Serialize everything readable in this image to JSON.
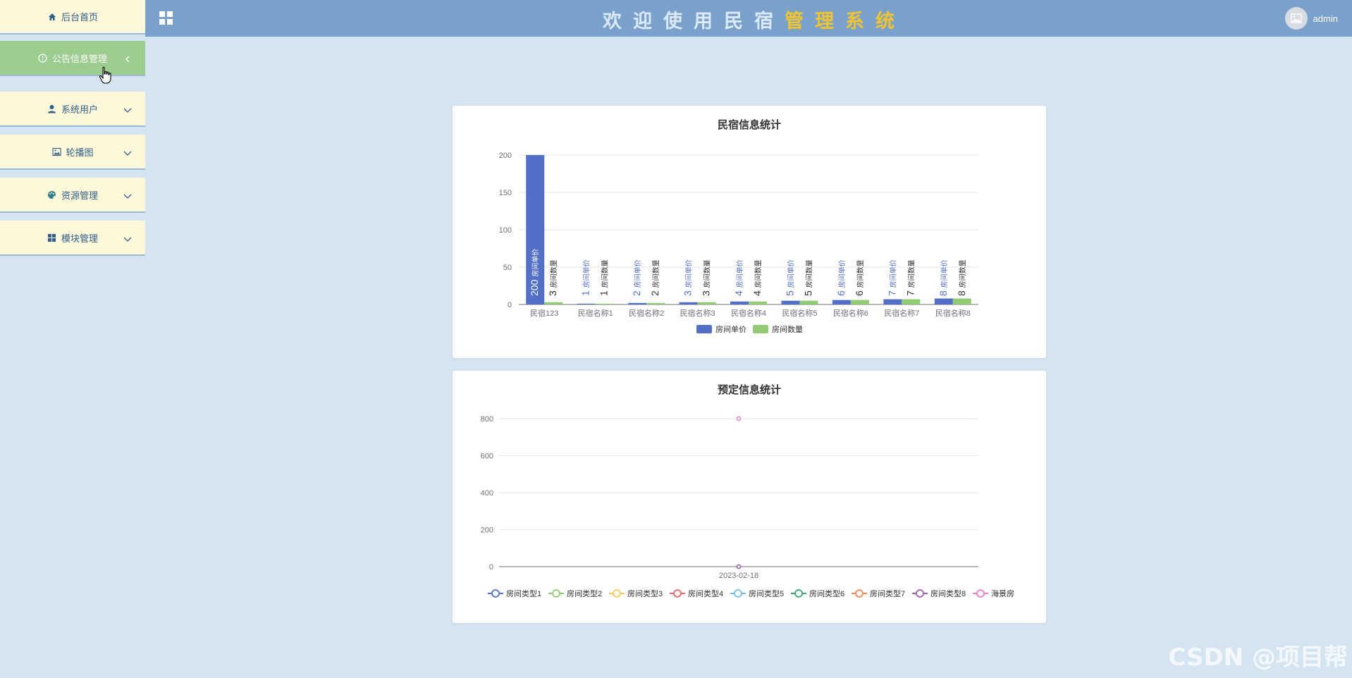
{
  "sidebar": {
    "items": [
      {
        "label": "后台首页",
        "icon": "home-icon"
      },
      {
        "label": "公告信息管理",
        "icon": "info-icon"
      },
      {
        "label": "系统用户",
        "icon": "user-icon"
      },
      {
        "label": "轮播图",
        "icon": "image-icon"
      },
      {
        "label": "资源管理",
        "icon": "paint-icon"
      },
      {
        "label": "模块管理",
        "icon": "grid-icon"
      }
    ]
  },
  "header": {
    "title_chars": [
      "欢",
      "迎",
      "使",
      "用",
      "民",
      "宿",
      "管",
      "理",
      "系",
      "统"
    ],
    "user_name": "admin"
  },
  "colors": {
    "sidebar_bg": "#fdf8d9",
    "sidebar_active_bg": "#9ccc8e",
    "header_bg": "#7aa0cc",
    "page_bg": "#d4e4f1",
    "title_light": "#dce9f7",
    "title_accent": "#f0c331"
  },
  "chart_data": [
    {
      "type": "bar",
      "title": "民宿信息统计",
      "categories": [
        "民宿123",
        "民宿名称1",
        "民宿名称2",
        "民宿名称3",
        "民宿名称4",
        "民宿名称5",
        "民宿名称6",
        "民宿名称7",
        "民宿名称8"
      ],
      "series": [
        {
          "name": "房间单价",
          "values": [
            200,
            1,
            2,
            3,
            4,
            5,
            6,
            7,
            8
          ],
          "color": "#5470c6"
        },
        {
          "name": "房间数量",
          "values": [
            3,
            1,
            2,
            3,
            4,
            5,
            6,
            7,
            8
          ],
          "color": "#91cc75"
        }
      ],
      "ylim": [
        0,
        200
      ],
      "yticks": [
        0,
        50,
        100,
        150,
        200
      ],
      "grid": true,
      "legend": "bottom",
      "data_label_series_names": true
    },
    {
      "type": "line",
      "title": "预定信息统计",
      "x": [
        "2023-02-18"
      ],
      "series": [
        {
          "name": "房间类型1",
          "values": [
            0
          ],
          "color": "#5470c6"
        },
        {
          "name": "房间类型2",
          "values": [
            0
          ],
          "color": "#91cc75"
        },
        {
          "name": "房间类型3",
          "values": [
            0
          ],
          "color": "#fac858"
        },
        {
          "name": "房间类型4",
          "values": [
            0
          ],
          "color": "#ee6666"
        },
        {
          "name": "房间类型5",
          "values": [
            0
          ],
          "color": "#73c0de"
        },
        {
          "name": "房间类型6",
          "values": [
            0
          ],
          "color": "#3ba272"
        },
        {
          "name": "房间类型7",
          "values": [
            0
          ],
          "color": "#fc8452"
        },
        {
          "name": "房间类型8",
          "values": [
            0
          ],
          "color": "#9a60b4"
        },
        {
          "name": "海景房",
          "values": [
            800
          ],
          "color": "#ea7ccc"
        }
      ],
      "ylim": [
        0,
        800
      ],
      "yticks": [
        0,
        200,
        400,
        600,
        800
      ],
      "grid": true,
      "legend": "bottom"
    }
  ],
  "watermark": "CSDN @项目帮"
}
